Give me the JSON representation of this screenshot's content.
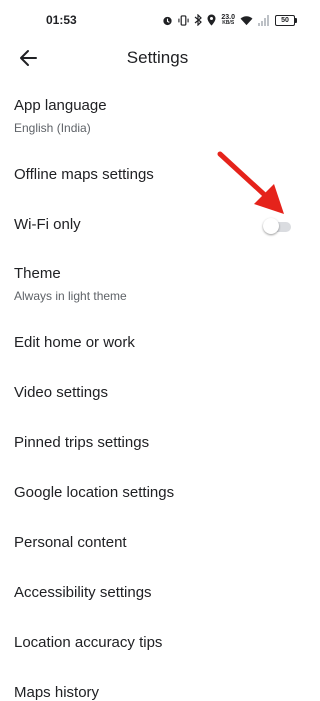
{
  "status_bar": {
    "time": "01:53",
    "network_speed_value": "23.0",
    "network_speed_unit": "KB/S",
    "battery": "50",
    "icons": [
      "alarm-icon",
      "vibrate-icon",
      "bluetooth-icon",
      "location-icon",
      "wifi-icon",
      "signal-icon",
      "battery-icon"
    ]
  },
  "app_bar": {
    "title": "Settings",
    "back_icon": "arrow-back-icon"
  },
  "settings": {
    "items": [
      {
        "label": "App language",
        "sublabel": "English (India)"
      },
      {
        "label": "Offline maps settings"
      },
      {
        "label": "Wi-Fi only",
        "toggle": false
      },
      {
        "label": "Theme",
        "sublabel": "Always in light theme"
      },
      {
        "label": "Edit home or work"
      },
      {
        "label": "Video settings"
      },
      {
        "label": "Pinned trips settings"
      },
      {
        "label": "Google location settings"
      },
      {
        "label": "Personal content"
      },
      {
        "label": "Accessibility settings"
      },
      {
        "label": "Location accuracy tips"
      },
      {
        "label": "Maps history"
      }
    ]
  },
  "annotation": {
    "arrow_color": "#e5231b"
  }
}
